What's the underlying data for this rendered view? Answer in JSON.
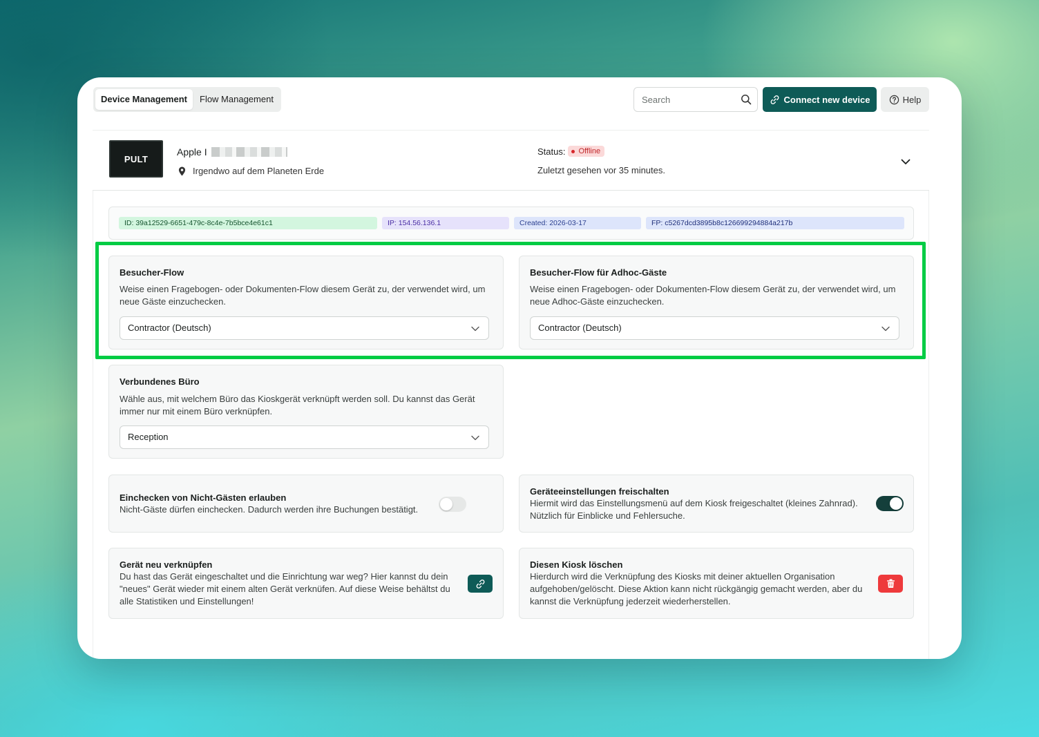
{
  "tabs": [
    {
      "label": "Device Management",
      "active": true
    },
    {
      "label": "Flow Management",
      "active": false
    }
  ],
  "search": {
    "placeholder": "Search",
    "value": "",
    "icon": "search-icon"
  },
  "connect_button": {
    "label": "Connect new device",
    "icon": "link-icon"
  },
  "help_button": {
    "label": "Help",
    "icon": "help-circle-icon"
  },
  "device": {
    "thumbnail_text": "PULT",
    "name": "Apple I",
    "location": "Irgendwo auf dem Planeten Erde",
    "status_label": "Status:",
    "status": "Offline",
    "last_seen": "Zuletzt gesehen vor 35 minutes."
  },
  "identifiers": {
    "id": "ID: 39a12529-6651-479c-8c4e-7b5bce4e61c1",
    "ip": "IP: 154.56.136.1",
    "created": "Created: 2026-03-17",
    "fp": "FP: c5267dcd3895b8c126699294884a217b"
  },
  "visitor_flow": {
    "title": "Besucher-Flow",
    "description": "Weise einen Fragebogen- oder Dokumenten-Flow diesem Gerät zu, der verwendet wird, um neue Gäste einzuchecken.",
    "selected": "Contractor (Deutsch)"
  },
  "adhoc_flow": {
    "title": "Besucher-Flow für Adhoc-Gäste",
    "description": "Weise einen Fragebogen- oder Dokumenten-Flow diesem Gerät zu, der verwendet wird, um neue Adhoc-Gäste einzuchecken.",
    "selected": "Contractor (Deutsch)"
  },
  "office": {
    "title": "Verbundenes Büro",
    "description": "Wähle aus, mit welchem Büro das Kioskgerät verknüpft werden soll. Du kannst das Gerät immer nur mit einem Büro verknüpfen.",
    "selected": "Reception"
  },
  "non_guest_checkin": {
    "title": "Einchecken von Nicht-Gästen erlauben",
    "description": "Nicht-Gäste dürfen einchecken. Dadurch werden ihre Buchungen bestätigt.",
    "enabled": false
  },
  "unlock_settings": {
    "title": "Geräteeinstellungen freischalten",
    "description": "Hiermit wird das Einstellungsmenü auf dem Kiosk freigeschaltet (kleines Zahnrad). Nützlich für Einblicke und Fehlersuche.",
    "enabled": true
  },
  "relink": {
    "title": "Gerät neu verknüpfen",
    "description": "Du hast das Gerät eingeschaltet und die Einrichtung war weg? Hier kannst du dein \"neues\" Gerät wieder mit einem alten Gerät verknüfen. Auf diese Weise behältst du alle Statistiken und Einstellungen!",
    "icon": "link-icon"
  },
  "delete_kiosk": {
    "title": "Diesen Kiosk löschen",
    "description": "Hierdurch wird die Verknüpfung des Kiosks mit deiner aktuellen Organisation aufgehoben/gelöscht. Diese Aktion kann nicht rückgängig gemacht werden, aber du kannst die Verknüpfung jederzeit wiederherstellen.",
    "icon": "trash-icon"
  },
  "colors": {
    "primary": "#0e5b57",
    "danger": "#ee3a3c",
    "highlight": "#00cc44",
    "offline_badge": "#fbd9d9"
  }
}
